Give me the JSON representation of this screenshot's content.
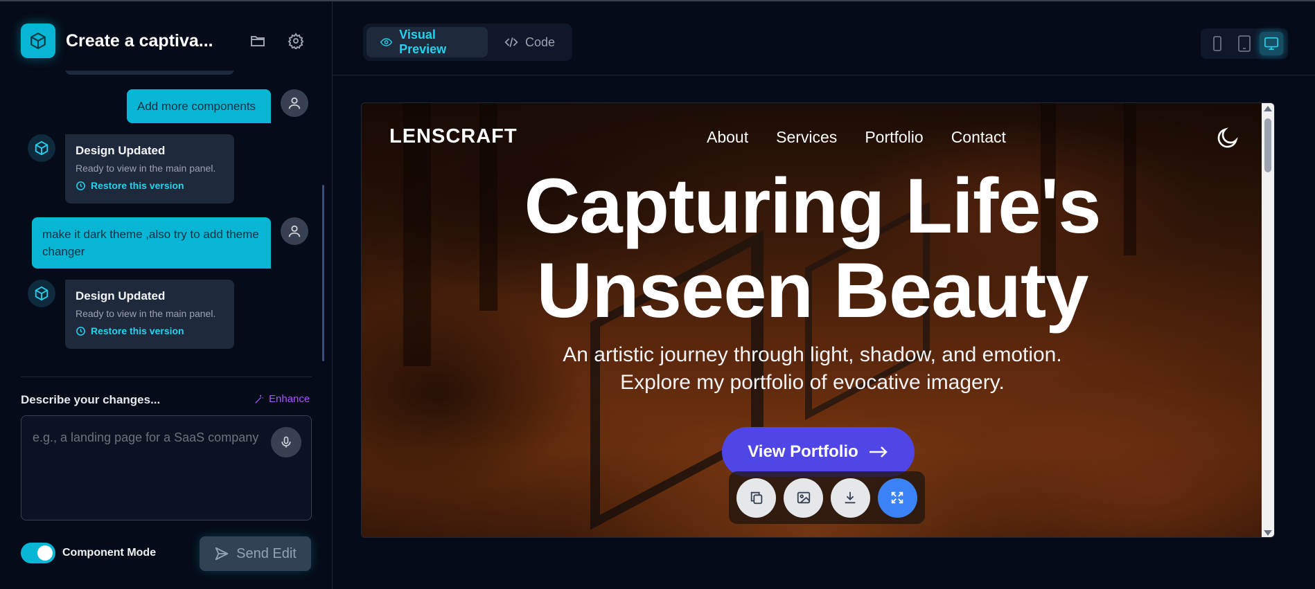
{
  "sidebar": {
    "title": "Create a captiva...",
    "messages": {
      "user1": "Add more components",
      "bot1": {
        "title": "Design Updated",
        "subtitle": "Ready to view in the main panel.",
        "restore": "Restore this version"
      },
      "user2": "make it dark theme ,also try to add theme changer",
      "bot2": {
        "title": "Design Updated",
        "subtitle": "Ready to view in the main panel.",
        "restore": "Restore this version"
      }
    },
    "describe_label": "Describe your changes...",
    "enhance_label": "Enhance",
    "input_placeholder": "e.g., a landing page for a SaaS company",
    "input_value": "",
    "component_mode_label": "Component Mode",
    "component_mode_on": true,
    "send_label": "Send Edit"
  },
  "main": {
    "tabs": [
      {
        "label": "Visual Preview",
        "active": true
      },
      {
        "label": "Code",
        "active": false
      }
    ],
    "devices": [
      "mobile-icon",
      "tablet-icon",
      "desktop-icon"
    ],
    "active_device": "desktop-icon"
  },
  "preview": {
    "logo": "LENSCRAFT",
    "nav": [
      "About",
      "Services",
      "Portfolio",
      "Contact"
    ],
    "hero_line1": "Capturing Life's",
    "hero_line2": "Unseen Beauty",
    "subtitle_line1": "An artistic journey through light, shadow, and emotion.",
    "subtitle_line2": "Explore my portfolio of evocative imagery.",
    "cta_label": "View Portfolio",
    "toolbar": [
      "copy-icon",
      "image-icon",
      "download-icon",
      "fullscreen-icon"
    ]
  },
  "colors": {
    "accent": "#06b6d4",
    "cta": "#4f46e5",
    "enhance": "#a855f7",
    "toolbar_active": "#3b82f6"
  }
}
